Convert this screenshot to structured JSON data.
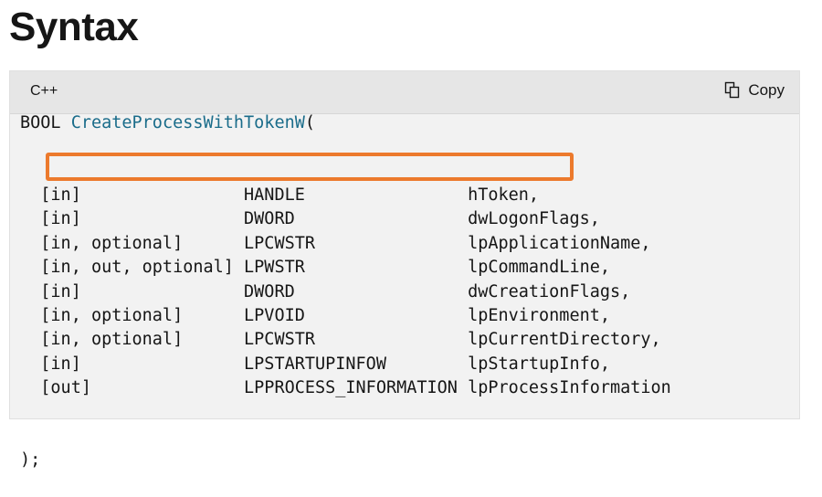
{
  "heading": "Syntax",
  "code_block": {
    "language": "C++",
    "copy_label": "Copy",
    "copy_icon": "copy-icon",
    "function_line": {
      "return_type": "BOOL",
      "function_name": "CreateProcessWithTokenW",
      "open_paren": "("
    },
    "parameters": [
      {
        "annotation": "[in]",
        "type": "HANDLE",
        "name": "hToken,"
      },
      {
        "annotation": "[in]",
        "type": "DWORD",
        "name": "dwLogonFlags,"
      },
      {
        "annotation": "[in, optional]",
        "type": "LPCWSTR",
        "name": "lpApplicationName,"
      },
      {
        "annotation": "[in, out, optional]",
        "type": "LPWSTR",
        "name": "lpCommandLine,"
      },
      {
        "annotation": "[in]",
        "type": "DWORD",
        "name": "dwCreationFlags,"
      },
      {
        "annotation": "[in, optional]",
        "type": "LPVOID",
        "name": "lpEnvironment,"
      },
      {
        "annotation": "[in, optional]",
        "type": "LPCWSTR",
        "name": "lpCurrentDirectory,"
      },
      {
        "annotation": "[in]",
        "type": "LPSTARTUPINFOW",
        "name": "lpStartupInfo,"
      },
      {
        "annotation": "[out]",
        "type": "LPPROCESS_INFORMATION",
        "name": "lpProcessInformation"
      }
    ],
    "closing_line": ");",
    "highlighted_parameter": "hToken",
    "highlight_color": "#ec7a2d"
  }
}
